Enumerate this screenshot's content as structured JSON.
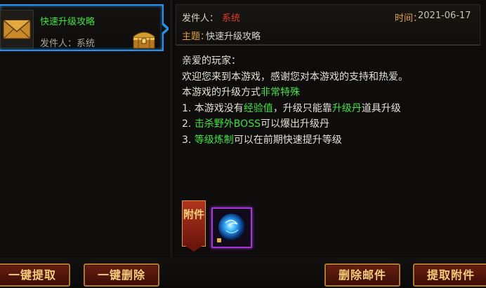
{
  "mail_list": {
    "items": [
      {
        "title": "快速升级攻略",
        "sender": "发件人：系统"
      }
    ]
  },
  "detail": {
    "sender_label": "发件人：",
    "sender_value": "系统",
    "time_label": "时间：",
    "time_value": "2021-06-17",
    "subject_label": "主题：",
    "subject_value": "快速升级攻略",
    "body": {
      "l1": "亲爱的玩家：",
      "l2": "欢迎您来到本游戏，感谢您对本游戏的支持和热爱。",
      "l3a": "本游戏的升级方式",
      "l3b": "非常特殊",
      "l4a": "1. 本游戏没有",
      "l4b": "经验值",
      "l4c": "，升级只能靠",
      "l4d": "升级丹",
      "l4e": "道具升级",
      "l5a": "2. ",
      "l5b": "击杀野外BOSS",
      "l5c": "可以爆出升级丹",
      "l6a": "3. ",
      "l6b": "等级炼制",
      "l6c": "可以在前期快速提升等级"
    },
    "attachment_label": "附件",
    "attachment_item_icon": "blue-orb-icon"
  },
  "buttons": {
    "claim_all": "一键提取",
    "delete_all": "一键删除",
    "delete_mail": "删除邮件",
    "claim_attachment": "提取附件"
  },
  "colors": {
    "accent": "#2a8fe8",
    "highlight": "#3fe23f",
    "label": "#e8a43a",
    "sender": "#e23a2a"
  }
}
